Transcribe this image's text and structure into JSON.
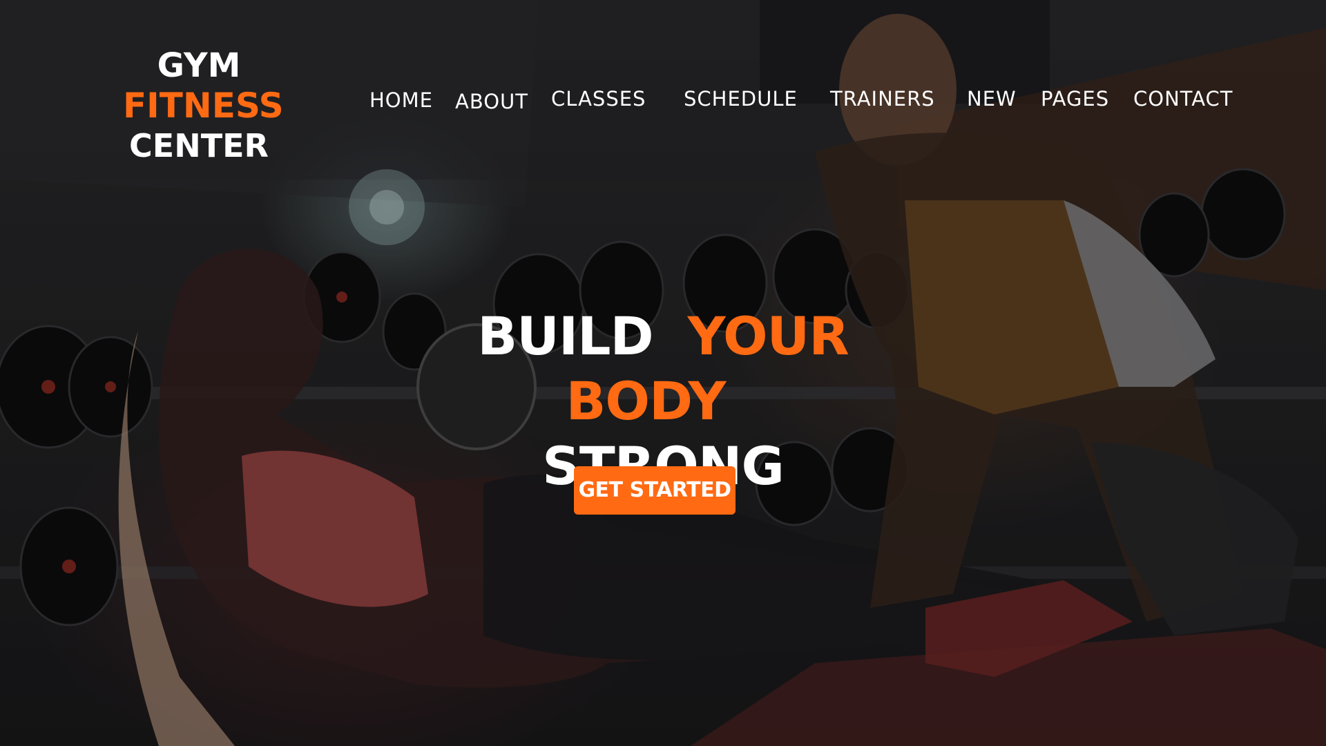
{
  "brand": {
    "line1": "GYM",
    "line2": "FITNESS",
    "line3": "CENTER",
    "accent_color": "#ff6a13"
  },
  "nav": {
    "items": [
      {
        "label": "HOME"
      },
      {
        "label": "ABOUT"
      },
      {
        "label": "CLASSES"
      },
      {
        "label": "SCHEDULE"
      },
      {
        "label": "TRAINERS"
      },
      {
        "label": "NEW"
      },
      {
        "label": "PAGES"
      },
      {
        "label": "CONTACT"
      }
    ]
  },
  "hero": {
    "headline": {
      "line1_a": "BUILD",
      "line1_b": "YOUR",
      "line2_a": "BODY",
      "line2_b": "STRONG"
    },
    "cta_label": "GET STARTED",
    "background_image": "gym-workout-photo"
  }
}
